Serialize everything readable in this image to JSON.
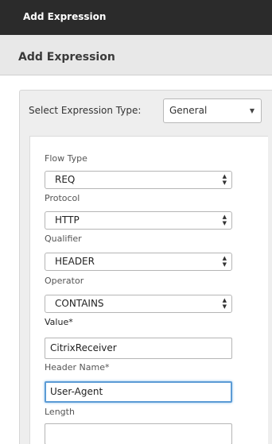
{
  "window": {
    "title": "Add Expression"
  },
  "dialog": {
    "header": "Add Expression"
  },
  "expression_type": {
    "label": "Select Expression Type:",
    "value": "General"
  },
  "fields": {
    "flow_type": {
      "label": "Flow Type",
      "value": "REQ"
    },
    "protocol": {
      "label": "Protocol",
      "value": "HTTP"
    },
    "qualifier": {
      "label": "Qualifier",
      "value": "HEADER"
    },
    "operator": {
      "label": "Operator",
      "value": "CONTAINS"
    },
    "value": {
      "label": "Value*",
      "value": "CitrixReceiver"
    },
    "header_name": {
      "label": "Header Name*",
      "value": "User-Agent"
    },
    "length": {
      "label": "Length",
      "value": ""
    }
  },
  "icons": {
    "dropdown": "caret-down-icon",
    "select_arrows": "up-down-arrows-icon"
  }
}
